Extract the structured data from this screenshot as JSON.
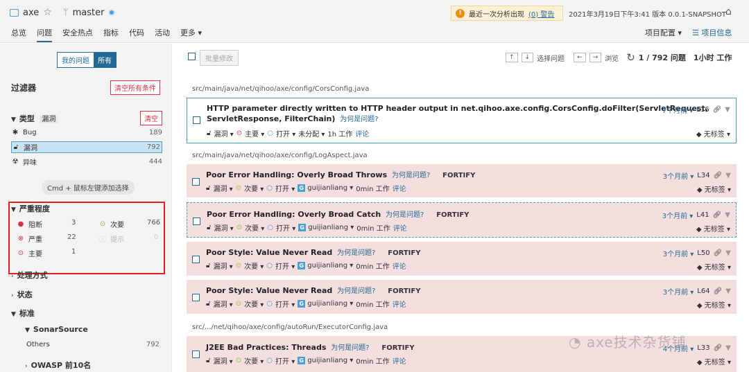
{
  "project": {
    "name": "axe",
    "branch": "master"
  },
  "warning": {
    "text": "最近一次分析出现",
    "link": "(0) 警告"
  },
  "meta": {
    "datetime": "2021年3月19日下午3:41",
    "version": "版本 0.0.1-SNAPSHOT"
  },
  "nav": {
    "items": [
      "总览",
      "问题",
      "安全热点",
      "指标",
      "代码",
      "活动",
      "更多 ▾"
    ],
    "config": "项目配置 ▾",
    "info": "项目信息"
  },
  "sidebar": {
    "my_issues": "我的问题",
    "all": "所有",
    "filters_title": "过滤器",
    "clear_all": "清空所有条件",
    "type_label": "类型",
    "type_tag": "漏洞",
    "clear": "清空",
    "types": [
      {
        "label": "Bug",
        "count": "189"
      },
      {
        "label": "漏洞",
        "count": "792"
      },
      {
        "label": "异味",
        "count": "444"
      }
    ],
    "cmd_hint": "Cmd + 鼠标左键添加选择",
    "severity_label": "严重程度",
    "severity": {
      "blocker": {
        "label": "阻断",
        "count": "3"
      },
      "minor": {
        "label": "次要",
        "count": "766"
      },
      "critical": {
        "label": "严重",
        "count": "22"
      },
      "info": {
        "label": "提示",
        "count": "0"
      },
      "major": {
        "label": "主要",
        "count": "1"
      }
    },
    "resolution_label": "处理方式",
    "status_label": "状态",
    "standard_label": "标准",
    "sonarsource_label": "SonarSource",
    "others_label": "Others",
    "others_count": "792",
    "owasp_label": "OWASP 前10名"
  },
  "toolbar": {
    "bulk": "批量修改",
    "select_issue": "选择问题",
    "browse": "浏览",
    "count": "1 / 792 问题",
    "effort": "1小时 工作"
  },
  "common": {
    "why": "为何是问题?",
    "type": "漏洞 ▾",
    "open": "打开 ▾",
    "comment": "评论",
    "no_tag": "无标签 ▾",
    "fortify": "FORTIFY"
  },
  "groups": [
    {
      "path": "src/main/java/net/qihoo/axe/config/CorsConfig.java"
    },
    {
      "path": "src/main/java/net/qihoo/axe/config/LogAspect.java"
    },
    {
      "path": "src/.../net/qihoo/axe/config/autoRun/ExecutorConfig.java"
    }
  ],
  "issues": [
    {
      "title": "HTTP parameter directly written to HTTP header output in net.qihoo.axe.config.CorsConfig.doFilter(ServletRequest,",
      "title2": "ServletResponse, FilterChain)",
      "severity": "主要 ▾",
      "assignee": "未分配 ▾",
      "effort": "1h 工作",
      "age": "7个月前 ▾",
      "line": "L16"
    },
    {
      "title": "Poor Error Handling: Overly Broad Throws",
      "severity": "次要 ▾",
      "assignee": "guijianliang ▾",
      "effort": "0min 工作",
      "age": "3个月前 ▾",
      "line": "L34"
    },
    {
      "title": "Poor Error Handling: Overly Broad Catch",
      "severity": "次要 ▾",
      "assignee": "guijianliang ▾",
      "effort": "0min 工作",
      "age": "3个月前 ▾",
      "line": "L41"
    },
    {
      "title": "Poor Style: Value Never Read",
      "severity": "次要 ▾",
      "assignee": "guijianliang ▾",
      "effort": "0min 工作",
      "age": "3个月前 ▾",
      "line": "L50"
    },
    {
      "title": "Poor Style: Value Never Read",
      "severity": "次要 ▾",
      "assignee": "guijianliang ▾",
      "effort": "0min 工作",
      "age": "3个月前 ▾",
      "line": "L64"
    },
    {
      "title": "J2EE Bad Practices: Threads",
      "severity": "次要 ▾",
      "assignee": "guijianliang ▾",
      "effort": "0min 工作",
      "age": "4个月前 ▾",
      "line": "L33"
    }
  ],
  "watermark": "axe技术杂货铺",
  "colors": {
    "accent": "#236a97",
    "issue_bg": "#f4dede",
    "red": "#d4333f",
    "warn": "#e88f13"
  }
}
